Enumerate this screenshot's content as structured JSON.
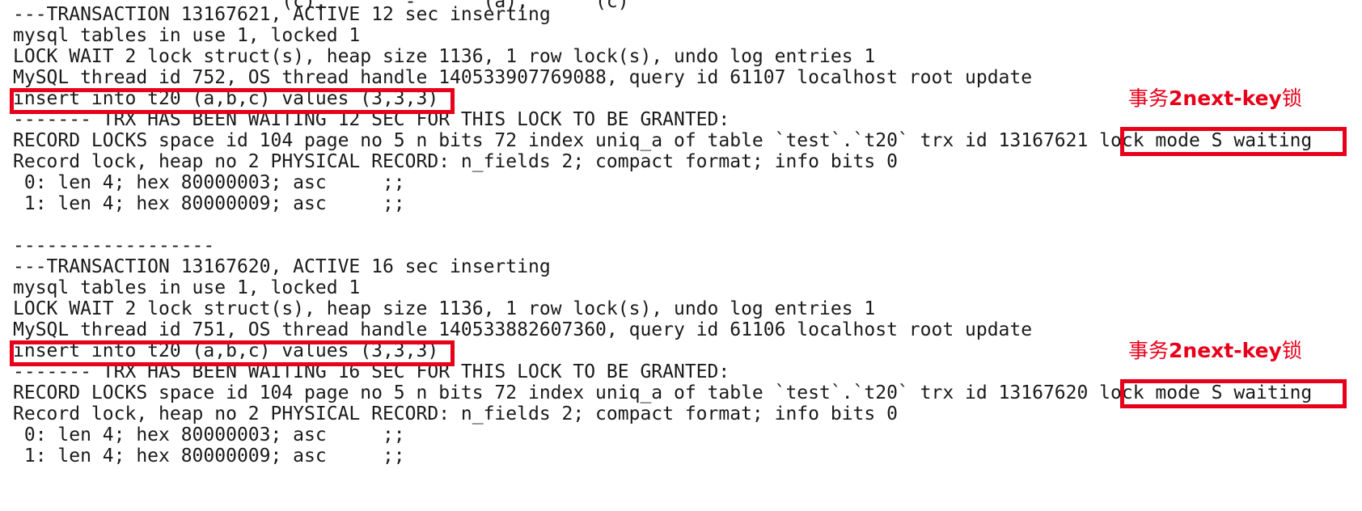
{
  "terminal": {
    "lines": {
      "l0": "                        (c),       -      (a),      (c)",
      "l1": "---TRANSACTION 13167621, ACTIVE 12 sec inserting",
      "l2": "mysql tables in use 1, locked 1",
      "l3": "LOCK WAIT 2 lock struct(s), heap size 1136, 1 row lock(s), undo log entries 1",
      "l4": "MySQL thread id 752, OS thread handle 140533907769088, query id 61107 localhost root update",
      "l5": "insert into t20 (a,b,c) values (3,3,3)",
      "l6": "------- TRX HAS BEEN WAITING 12 SEC FOR THIS LOCK TO BE GRANTED:",
      "l7": "RECORD LOCKS space id 104 page no 5 n bits 72 index uniq_a of table `test`.`t20` trx id 13167621 lock mode S waiting",
      "l8": "Record lock, heap no 2 PHYSICAL RECORD: n_fields 2; compact format; info bits 0",
      "l9": " 0: len 4; hex 80000003; asc     ;;",
      "l10": " 1: len 4; hex 80000009; asc     ;;",
      "l11": "",
      "l12": "------------------",
      "l13": "---TRANSACTION 13167620, ACTIVE 16 sec inserting",
      "l14": "mysql tables in use 1, locked 1",
      "l15": "LOCK WAIT 2 lock struct(s), heap size 1136, 1 row lock(s), undo log entries 1",
      "l16": "MySQL thread id 751, OS thread handle 140533882607360, query id 61106 localhost root update",
      "l17": "insert into t20 (a,b,c) values (3,3,3)",
      "l18": "------- TRX HAS BEEN WAITING 16 SEC FOR THIS LOCK TO BE GRANTED:",
      "l19": "RECORD LOCKS space id 104 page no 5 n bits 72 index uniq_a of table `test`.`t20` trx id 13167620 lock mode S waiting",
      "l20": "Record lock, heap no 2 PHYSICAL RECORD: n_fields 2; compact format; info bits 0",
      "l21": " 0: len 4; hex 80000003; asc     ;;",
      "l22": " 1: len 4; hex 80000009; asc     ;;"
    }
  },
  "annotations": {
    "note1": {
      "prefix": "事务",
      "bold": "2next-key",
      "suffix": "锁"
    },
    "note2": {
      "prefix": "事务",
      "bold": "2next-key",
      "suffix": "锁"
    },
    "highlight_color": "#e8001a"
  }
}
